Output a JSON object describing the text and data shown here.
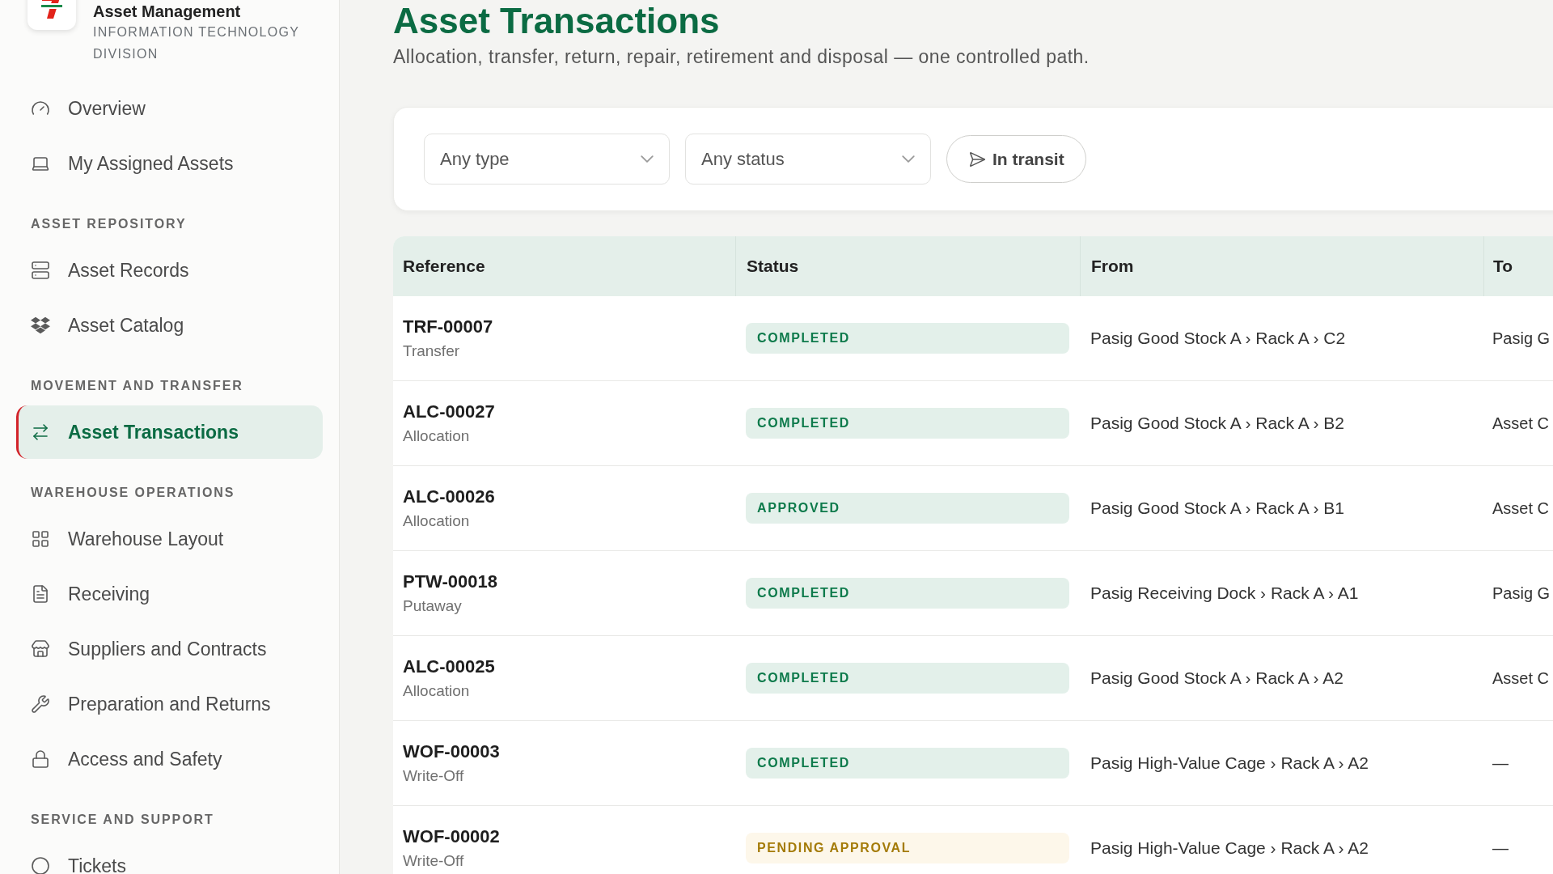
{
  "sidebar": {
    "brand": {
      "title": "Asset Management",
      "subtitle": "INFORMATION TECHNOLOGY DIVISION"
    },
    "groups": [
      {
        "items": [
          {
            "label": "Overview",
            "selected": false
          },
          {
            "label": "My Assigned Assets",
            "selected": false
          }
        ]
      },
      {
        "heading": "ASSET REPOSITORY",
        "items": [
          {
            "label": "Asset Records",
            "selected": false
          },
          {
            "label": "Asset Catalog",
            "selected": false
          }
        ]
      },
      {
        "heading": "MOVEMENT AND TRANSFER",
        "items": [
          {
            "label": "Asset Transactions",
            "selected": true
          }
        ]
      },
      {
        "heading": "WAREHOUSE OPERATIONS",
        "items": [
          {
            "label": "Warehouse Layout",
            "selected": false
          },
          {
            "label": "Receiving",
            "selected": false
          },
          {
            "label": "Suppliers and Contracts",
            "selected": false
          },
          {
            "label": "Preparation and Returns",
            "selected": false
          },
          {
            "label": "Access and Safety",
            "selected": false
          }
        ]
      },
      {
        "heading": "SERVICE AND SUPPORT",
        "items": [
          {
            "label": "Tickets",
            "selected": false
          }
        ]
      }
    ]
  },
  "page": {
    "title": "Asset Transactions",
    "subtitle": "Allocation, transfer, return, repair, retirement and disposal — one controlled path."
  },
  "filters": {
    "type_select": {
      "value": "Any type"
    },
    "status_select": {
      "value": "Any status"
    },
    "in_transit_toggle": {
      "label": "In transit",
      "selected": false
    }
  },
  "table": {
    "columns": [
      "Reference",
      "Status",
      "From",
      "To"
    ],
    "rows": [
      {
        "reference": "TRF-00007",
        "type": "Transfer",
        "status": {
          "label": "COMPLETED",
          "kind": "completed"
        },
        "from": "Pasig Good Stock A › Rack A › C2",
        "to": "Pasig G"
      },
      {
        "reference": "ALC-00027",
        "type": "Allocation",
        "status": {
          "label": "COMPLETED",
          "kind": "completed"
        },
        "from": "Pasig Good Stock A › Rack A › B2",
        "to": "Asset C"
      },
      {
        "reference": "ALC-00026",
        "type": "Allocation",
        "status": {
          "label": "APPROVED",
          "kind": "approved"
        },
        "from": "Pasig Good Stock A › Rack A › B1",
        "to": "Asset C"
      },
      {
        "reference": "PTW-00018",
        "type": "Putaway",
        "status": {
          "label": "COMPLETED",
          "kind": "completed"
        },
        "from": "Pasig Receiving Dock › Rack A › A1",
        "to": "Pasig G"
      },
      {
        "reference": "ALC-00025",
        "type": "Allocation",
        "status": {
          "label": "COMPLETED",
          "kind": "completed"
        },
        "from": "Pasig Good Stock A › Rack A › A2",
        "to": "Asset C"
      },
      {
        "reference": "WOF-00003",
        "type": "Write-Off",
        "status": {
          "label": "COMPLETED",
          "kind": "completed"
        },
        "from": "Pasig High-Value Cage › Rack A › A2",
        "to": "—"
      },
      {
        "reference": "WOF-00002",
        "type": "Write-Off",
        "status": {
          "label": "PENDING APPROVAL",
          "kind": "pending"
        },
        "from": "Pasig High-Value Cage › Rack A › A2",
        "to": "—"
      }
    ]
  }
}
